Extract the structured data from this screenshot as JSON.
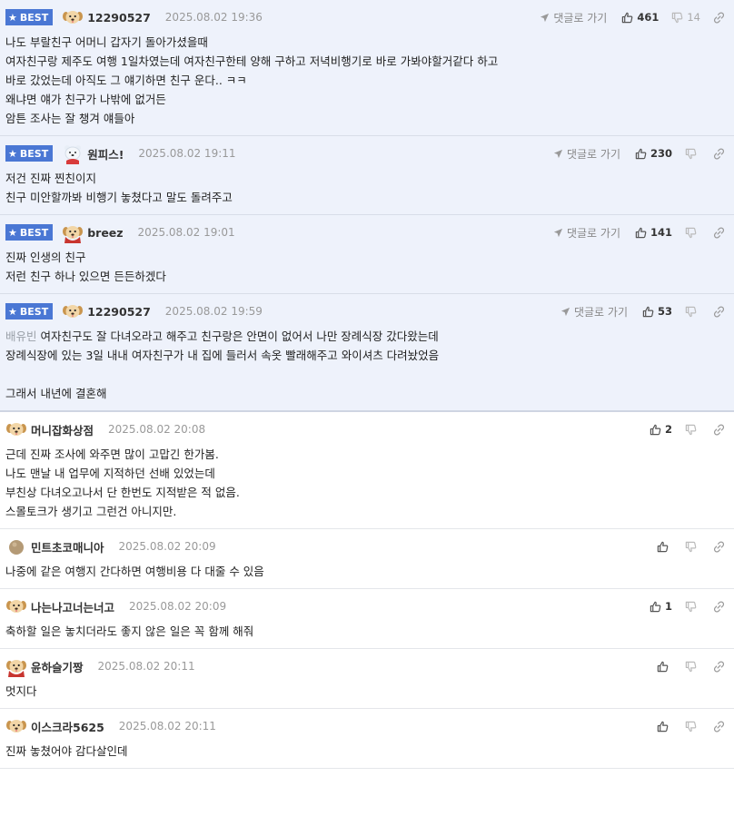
{
  "colors": {
    "best_bg": "#eef2fb",
    "best_badge": "#4a77d4",
    "divider": "#e4e6ea",
    "date": "#999999",
    "mention": "#9aa0a8"
  },
  "labels": {
    "best": "BEST",
    "reply_link": "댓글로 가기"
  },
  "comments": [
    {
      "best": true,
      "avatar": "puppy-avatar",
      "nick": "12290527",
      "date": "2025.08.02 19:36",
      "likes": "461",
      "dislikes": "14",
      "lines": [
        "나도 부랄친구 어머니 갑자기 돌아가셨을때",
        "여자친구랑 제주도 여행 1일차였는데 여자친구한테 양해 구하고 저녁비행기로 바로 가봐야할거같다 하고",
        "바로 갔었는데 아직도 그 얘기하면 친구 운다.. ㅋㅋ",
        "왜냐면 얘가 친구가 나밖에 없거든",
        "암튼 조사는 잘 챙겨 얘들아"
      ]
    },
    {
      "best": true,
      "avatar": "polar-bear-avatar",
      "nick": "원피스!",
      "date": "2025.08.02 19:11",
      "likes": "230",
      "dislikes": "",
      "lines": [
        "저건 진짜 찐친이지",
        "친구 미안할까봐 비행기 놓쳤다고 말도 돌려주고"
      ]
    },
    {
      "best": true,
      "avatar": "caped-puppy-avatar",
      "nick": "breez",
      "date": "2025.08.02 19:01",
      "likes": "141",
      "dislikes": "",
      "lines": [
        "진짜 인생의 친구",
        "저런 친구 하나 있으면 든든하겠다"
      ]
    },
    {
      "best": true,
      "avatar": "puppy-avatar",
      "nick": "12290527",
      "date": "2025.08.02 19:59",
      "likes": "53",
      "dislikes": "",
      "mention": "배유빈",
      "lines": [
        "여자친구도 잘 다녀오라고 해주고 친구랑은 안면이 없어서 나만 장례식장 갔다왔는데",
        "장례식장에 있는 3일 내내 여자친구가 내 집에 들러서 속옷 빨래해주고 와이셔츠 다려놨었음",
        "",
        "그래서 내년에 결혼해"
      ]
    },
    {
      "best": false,
      "avatar": "puppy-avatar",
      "nick": "머니잡화상점",
      "date": "2025.08.02 20:08",
      "likes": "2",
      "dislikes": "",
      "lines": [
        "근데 진짜 조사에 와주면 많이 고맙긴 한가봄.",
        "나도 맨날 내 업무에 지적하던 선배 있었는데",
        "부친상 다녀오고나서 단 한번도 지적받은 적 없음.",
        "스몰토크가 생기고 그런건 아니지만."
      ]
    },
    {
      "best": false,
      "avatar": "round-avatar",
      "nick": "민트초코매니아",
      "date": "2025.08.02 20:09",
      "likes": "",
      "dislikes": "",
      "lines": [
        "나중에 같은 여행지 간다하면 여행비용 다 대줄 수 있음"
      ]
    },
    {
      "best": false,
      "avatar": "puppy-avatar",
      "nick": "나는나고너는너고",
      "date": "2025.08.02 20:09",
      "likes": "1",
      "dislikes": "",
      "lines": [
        "축하할 일은 놓치더라도 좋지 않은 일은 꼭 함께 해줘"
      ]
    },
    {
      "best": false,
      "avatar": "caped-puppy-avatar",
      "nick": "윤하슬기짱",
      "date": "2025.08.02 20:11",
      "likes": "",
      "dislikes": "",
      "lines": [
        "멋지다"
      ]
    },
    {
      "best": false,
      "avatar": "puppy-avatar",
      "nick": "이스크라5625",
      "date": "2025.08.02 20:11",
      "likes": "",
      "dislikes": "",
      "lines": [
        "진짜 놓쳤어야 감다살인데"
      ]
    }
  ]
}
